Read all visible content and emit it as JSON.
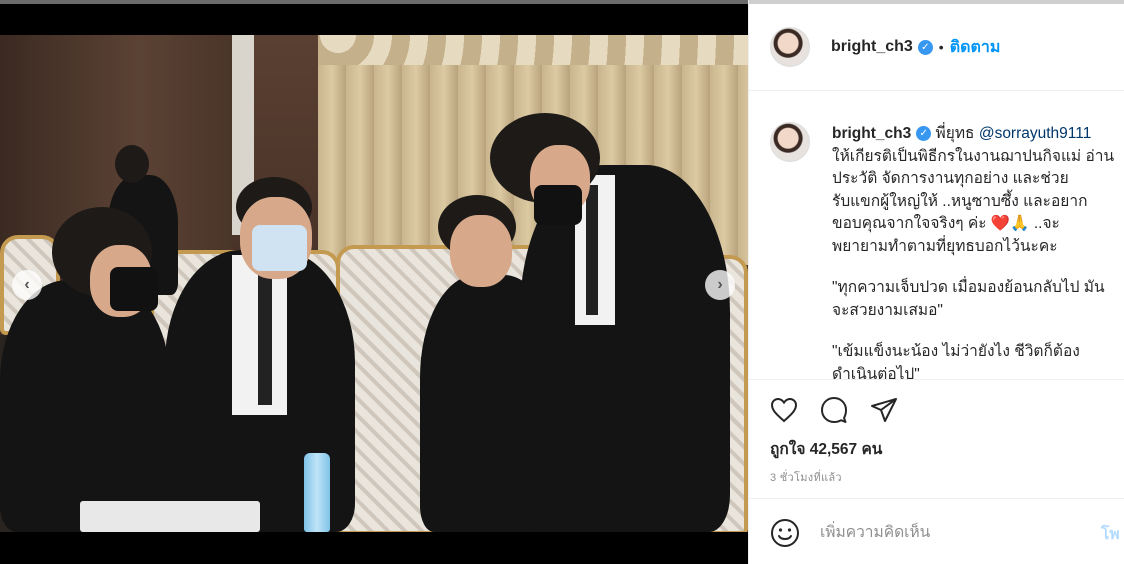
{
  "post": {
    "username": "bright_ch3",
    "follow_label": "ติดตาม",
    "dot": "•",
    "verified_icon": "✓"
  },
  "caption": {
    "username": "bright_ch3",
    "lead": " พี่ยุทธ ",
    "mention": "@sorrayuth9111",
    "lines": [
      "ให้เกียรติเป็นพิธีกรในงานฌาปนกิจแม่ อ่าน",
      "ประวัติ จัดการงานทุกอย่าง และช่วย",
      "รับแขกผู้ใหญ่ให้ ..หนูซาบซึ้ง และอยาก",
      "ขอบคุณจากใจจริงๆ ค่ะ ❤️🙏 ..จะ",
      "พยายามทำตามที่ยุทธบอกไว้นะคะ"
    ],
    "quote1": [
      "\"ทุกความเจ็บปวด เมื่อมองย้อนกลับไป มัน",
      "จะสวยงามเสมอ\""
    ],
    "quote2": [
      "\"เข้มแข็งนะน้อง ไม่ว่ายังไง ชีวิตก็ต้อง",
      "ดำเนินต่อไป\""
    ]
  },
  "actions": {
    "like_icon": "heart-outline",
    "comment_icon": "speech-bubble",
    "share_icon": "paper-plane"
  },
  "likes_text": "ถูกใจ 42,567 คน",
  "time_text": "3 ชั่วโมงที่แล้ว",
  "comment_box": {
    "placeholder": "เพิ่มความคิดเห็น",
    "post_label": "โพ"
  },
  "colors": {
    "accent": "#0095f6",
    "verified": "#3897f0",
    "muted": "#8e8e8e"
  }
}
